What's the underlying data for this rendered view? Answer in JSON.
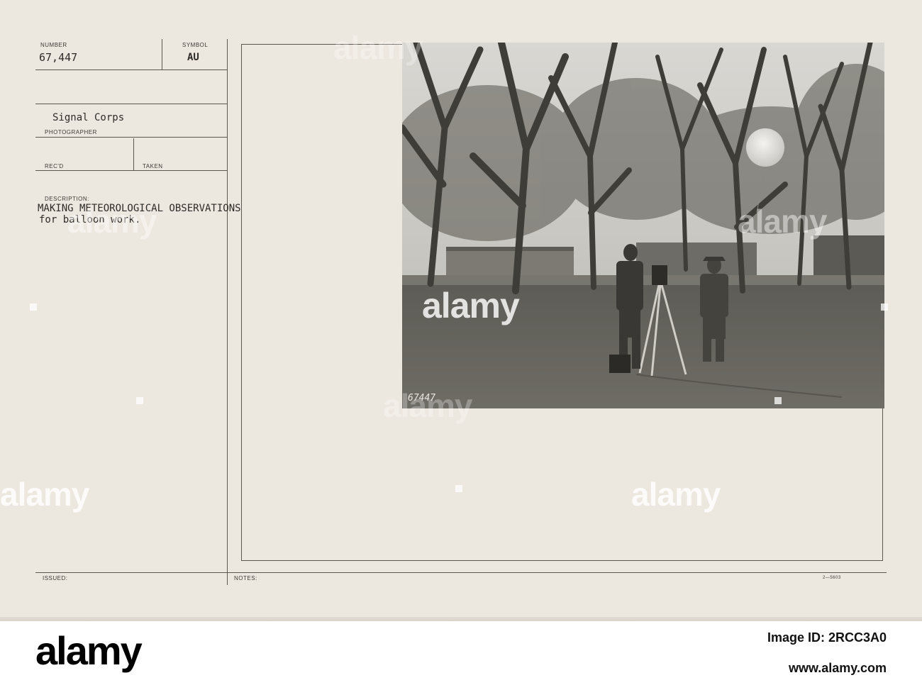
{
  "card": {
    "number_label": "NUMBER",
    "number_value": "67,447",
    "symbol_label": "SYMBOL",
    "symbol_value": "AU",
    "photographer_value": "Signal Corps",
    "photographer_label": "PHOTOGRAPHER",
    "recd_label": "REC'D",
    "taken_label": "TAKEN",
    "description_label": "DESCRIPTION:",
    "description_line1": "MAKING METEOROLOGICAL OBSERVATIONS",
    "description_line2": "for balloon work.",
    "issued_label": "ISSUED:",
    "notes_label": "NOTES:",
    "form_code": "2—5603"
  },
  "photo": {
    "negative_number": "67447"
  },
  "watermarks": [
    "alamy",
    "alamy",
    "alamy",
    "alamy",
    "alamy",
    "alamy",
    "alamy"
  ],
  "stock": {
    "logo": "alamy",
    "image_id": "Image ID: 2RCC3A0",
    "site": "www.alamy.com"
  }
}
